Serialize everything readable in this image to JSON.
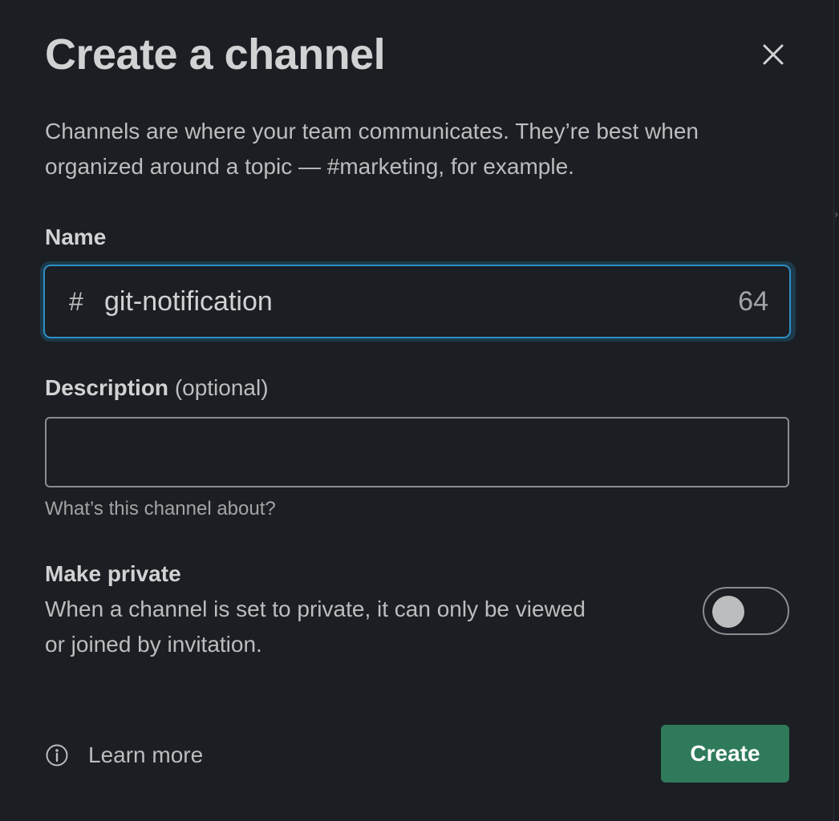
{
  "dialog": {
    "title": "Create a channel",
    "close_icon": "close-icon",
    "intro": "Channels are where your team communicates. They’re best when organized around a topic — #marketing, for example."
  },
  "name_section": {
    "label": "Name",
    "prefix": "#",
    "value": "git-notification",
    "char_remaining": "64"
  },
  "description_section": {
    "label": "Description",
    "optional": "(optional)",
    "value": "",
    "hint": "What’s this channel about?"
  },
  "private_section": {
    "label": "Make private",
    "description": "When a channel is set to private, it can only be viewed or joined by invitation.",
    "enabled": false
  },
  "footer": {
    "info_icon": "info-icon",
    "learn_more": "Learn more",
    "create_label": "Create"
  },
  "colors": {
    "background": "#1b1e22",
    "focus_border": "#2f8fc6",
    "primary_button": "#2f7a5b",
    "text": "#d1d2d3"
  }
}
